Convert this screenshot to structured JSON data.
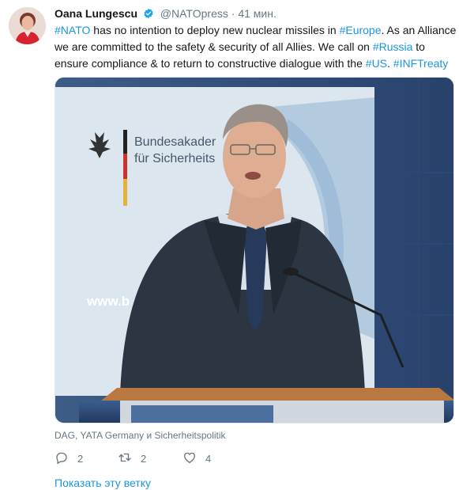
{
  "tweet": {
    "author_name": "Oana Lungescu",
    "handle": "@NATOpress",
    "separator": "·",
    "time": "41 мин.",
    "text_lines": [
      [
        {
          "t": "#NATO",
          "tag": true
        },
        {
          "t": " has no intention to deploy new nuclear missiles in ",
          "tag": false
        },
        {
          "t": "#Europe",
          "tag": true
        },
        {
          "t": ". As an Alliance",
          "tag": false
        }
      ],
      [
        {
          "t": "we are committed to the safety & security of all Allies. We call on ",
          "tag": false
        },
        {
          "t": "#Russia",
          "tag": true
        },
        {
          "t": " to",
          "tag": false
        }
      ],
      [
        {
          "t": "ensure compliance & to return to constructive dialogue with the ",
          "tag": false
        },
        {
          "t": "#US",
          "tag": true
        },
        {
          "t": ". ",
          "tag": false
        },
        {
          "t": "#INFTreaty",
          "tag": true
        }
      ]
    ],
    "media": {
      "banner_text_1": "Bundesakader",
      "banner_text_2": "für Sicherheits",
      "banner_url_text": "www.b"
    },
    "media_caption": "DAG, YATA Germany и Sicherheitspolitik",
    "reply_count": "2",
    "retweet_count": "2",
    "like_count": "4",
    "show_thread_label": "Показать эту ветку"
  },
  "colors": {
    "link": "#1b95e0",
    "muted": "#657786",
    "text": "#14171a",
    "verified": "#1da1f2"
  },
  "icons": {
    "verified": "verified-badge-icon",
    "reply": "reply-icon",
    "retweet": "retweet-icon",
    "like": "heart-icon"
  }
}
